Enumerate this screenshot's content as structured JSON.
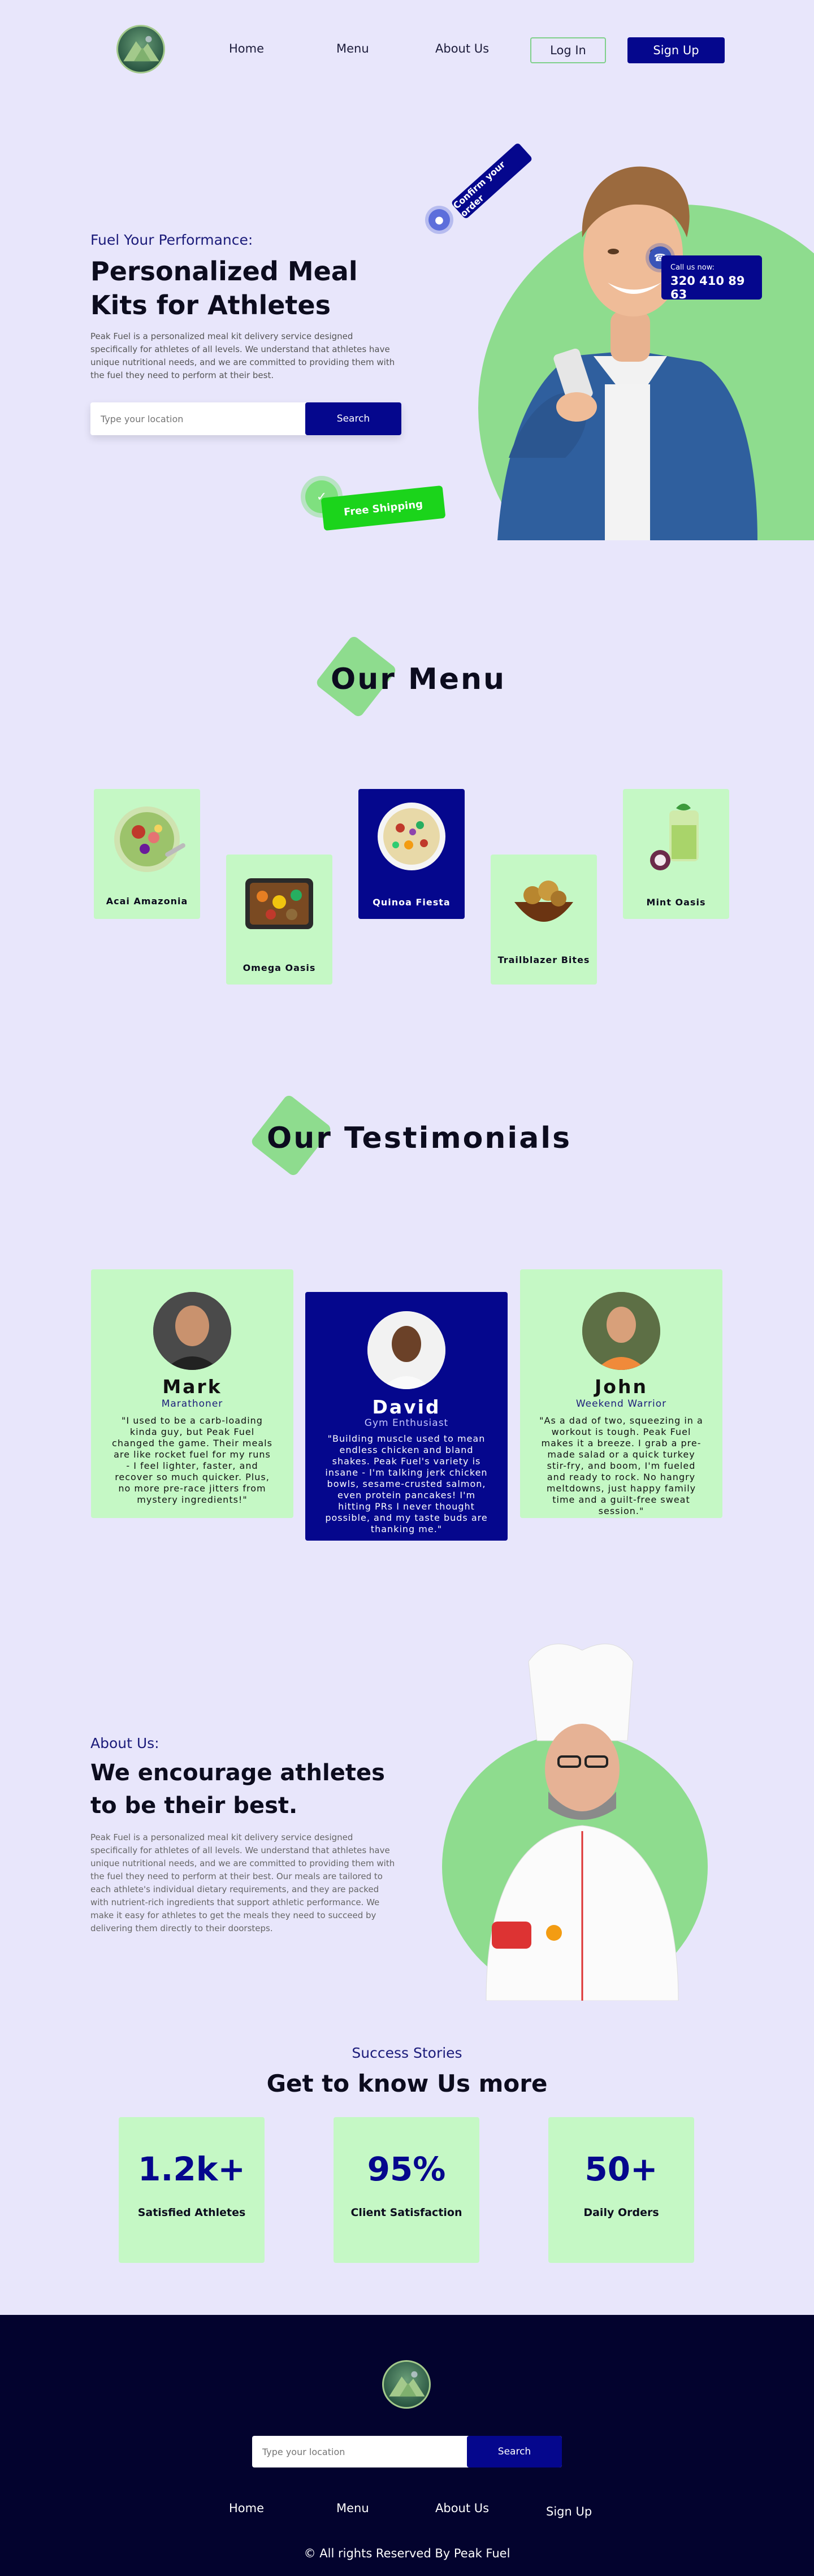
{
  "nav": {
    "links": [
      "Home",
      "Menu",
      "About Us"
    ],
    "login_label": "Log In",
    "signup_label": "Sign Up"
  },
  "hero": {
    "subtitle": "Fuel Your Performance:",
    "title": "Personalized Meal Kits for Athletes",
    "description": "Peak Fuel is a personalized meal kit delivery service designed specifically for athletes of all levels. We understand that athletes have unique nutritional needs, and we are committed to providing them with the fuel they need to perform at their best.",
    "search_placeholder": "Type your location",
    "search_label": "Search",
    "confirm_tag": "Confirm your order",
    "call_label": "Call us now:",
    "call_number": "320 410 89 63",
    "shipping_tag": "Free Shipping"
  },
  "menu": {
    "heading_highlight": "Our",
    "heading_rest": "Menu",
    "items": [
      {
        "name": "Acai Amazonia",
        "active": false
      },
      {
        "name": "Omega Oasis",
        "active": false
      },
      {
        "name": "Quinoa Fiesta",
        "active": true
      },
      {
        "name": "Trailblazer Bites",
        "active": false
      },
      {
        "name": "Mint Oasis",
        "active": false
      }
    ]
  },
  "testimonials": {
    "heading_highlight": "Our",
    "heading_rest": "Testimonials",
    "items": [
      {
        "name": "Mark",
        "role": "Marathoner",
        "quote": "\"I used to be a carb-loading kinda guy, but Peak Fuel changed the game. Their meals are like rocket fuel for my runs - I feel lighter, faster, and recover so much quicker. Plus, no more pre-race jitters from mystery ingredients!\""
      },
      {
        "name": "David",
        "role": "Gym Enthusiast",
        "quote": "\"Building muscle used to mean endless chicken and bland shakes. Peak Fuel's variety is insane - I'm talking jerk chicken bowls, sesame-crusted salmon, even protein pancakes! I'm hitting PRs I never thought possible, and my taste buds are thanking me.\""
      },
      {
        "name": "John",
        "role": "Weekend Warrior",
        "quote": "\"As a dad of two, squeezing in a workout is tough. Peak Fuel makes it a breeze. I grab a pre-made salad or a quick turkey stir-fry, and boom, I'm fueled and ready to rock. No hangry meltdowns, just happy family time and a guilt-free sweat session.\""
      }
    ]
  },
  "about": {
    "subtitle": "About Us:",
    "title": "We encourage athletes to be their best.",
    "description": "Peak Fuel is a personalized meal kit delivery service designed specifically for athletes of all levels. We understand that athletes have unique nutritional needs, and we are committed to providing them with the fuel they need to perform at their best. Our meals are tailored to each athlete's individual dietary requirements, and they are packed with nutrient-rich ingredients that support athletic performance. We make it easy for athletes to get the meals they need to succeed by delivering them directly to their doorsteps."
  },
  "stats": {
    "subtitle": "Success Stories",
    "title": "Get to know Us more",
    "items": [
      {
        "value": "1.2k+",
        "label": "Satisfied Athletes"
      },
      {
        "value": "95%",
        "label": "Client Satisfaction"
      },
      {
        "value": "50+",
        "label": "Daily Orders"
      }
    ]
  },
  "footer": {
    "search_placeholder": "Type your location",
    "search_label": "Search",
    "links": [
      "Home",
      "Menu",
      "About Us",
      "Sign Up"
    ],
    "copyright": "© All rights Reserved By Peak Fuel"
  },
  "colors": {
    "background": "#e8e6fb",
    "primary": "#05078d",
    "accent_green": "#8edc8e",
    "card_green": "#c5f8c5",
    "footer": "#03032e"
  }
}
